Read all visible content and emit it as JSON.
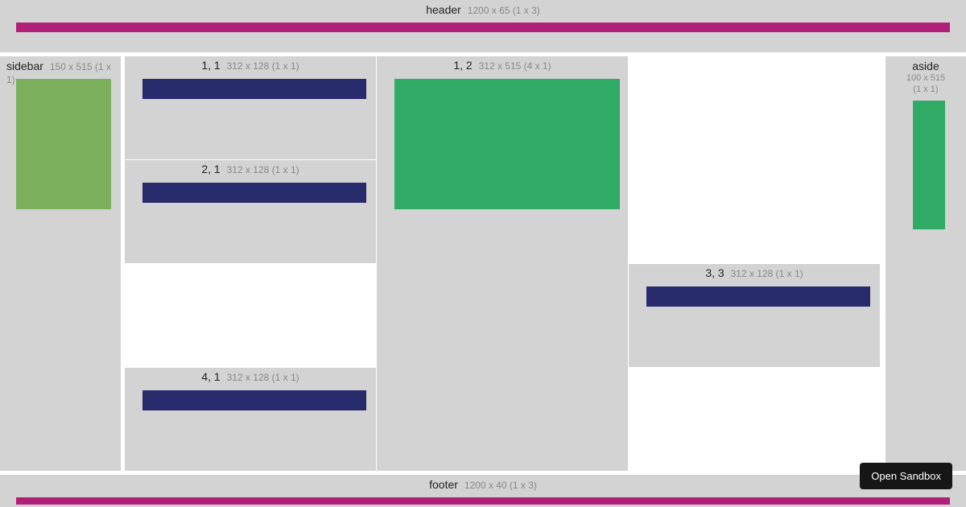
{
  "header": {
    "label": "header",
    "dims": "1200 x 65  (1 x 3)"
  },
  "sidebar": {
    "label": "sidebar",
    "dims": "150 x 515  (1 x 1)"
  },
  "aside": {
    "label": "aside",
    "dims_line1": "100 x 515",
    "dims_line2": "(1 x 1)"
  },
  "footer": {
    "label": "footer",
    "dims": "1200 x 40  (1 x 3)"
  },
  "cells": {
    "c11": {
      "label": "1, 1",
      "dims": "312 x 128  (1 x 1)"
    },
    "c21": {
      "label": "2, 1",
      "dims": "312 x 128  (1 x 1)"
    },
    "c41": {
      "label": "4, 1",
      "dims": "312 x 128  (1 x 1)"
    },
    "c12": {
      "label": "1, 2",
      "dims": "312 x 515  (4 x 1)"
    },
    "c33": {
      "label": "3, 3",
      "dims": "312 x 128  (1 x 1)"
    }
  },
  "button": {
    "open_sandbox": "Open Sandbox"
  },
  "colors": {
    "region_bg": "#d3d3d3",
    "magenta": "#b02079",
    "green_sidebar": "#7cb05c",
    "green_bright": "#2fab66",
    "navy": "#272a6b",
    "btn_bg": "#161616"
  }
}
